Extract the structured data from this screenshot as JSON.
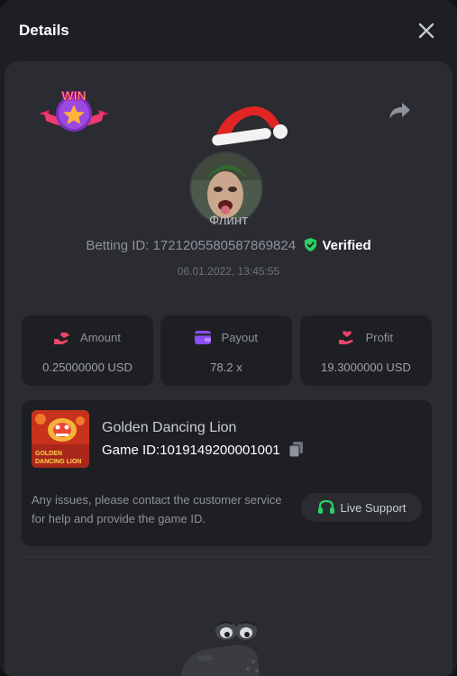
{
  "header": {
    "title": "Details"
  },
  "bet": {
    "username": "Флинт",
    "betting_id_label": "Betting ID:",
    "betting_id": "1721205580587869824",
    "verified_label": "Verified",
    "datetime": "06.01.2022, 13:45:55"
  },
  "badge": {
    "text": "WIN"
  },
  "stats": [
    {
      "label": "Amount",
      "value": "0.25000000 USD",
      "icon": "hand-coin-icon",
      "color": "#e8456b"
    },
    {
      "label": "Payout",
      "value": "78.2 x",
      "icon": "wallet-icon",
      "color": "#8b4cf0"
    },
    {
      "label": "Profit",
      "value": "19.3000000 USD",
      "icon": "hand-heart-icon",
      "color": "#e8456b"
    }
  ],
  "game": {
    "name": "Golden Dancing Lion",
    "id_label": "Game ID:",
    "id": "1019149200001001",
    "thumb_text_1": "GOLDEN",
    "thumb_text_2": "DANCING LION",
    "help_text": "Any issues, please contact the customer service for help and provide the game ID.",
    "support_label": "Live Support"
  },
  "colors": {
    "verified_green": "#2bd163",
    "support_green": "#2bd163",
    "background": "#1e1f23",
    "card": "#2a2c31"
  }
}
